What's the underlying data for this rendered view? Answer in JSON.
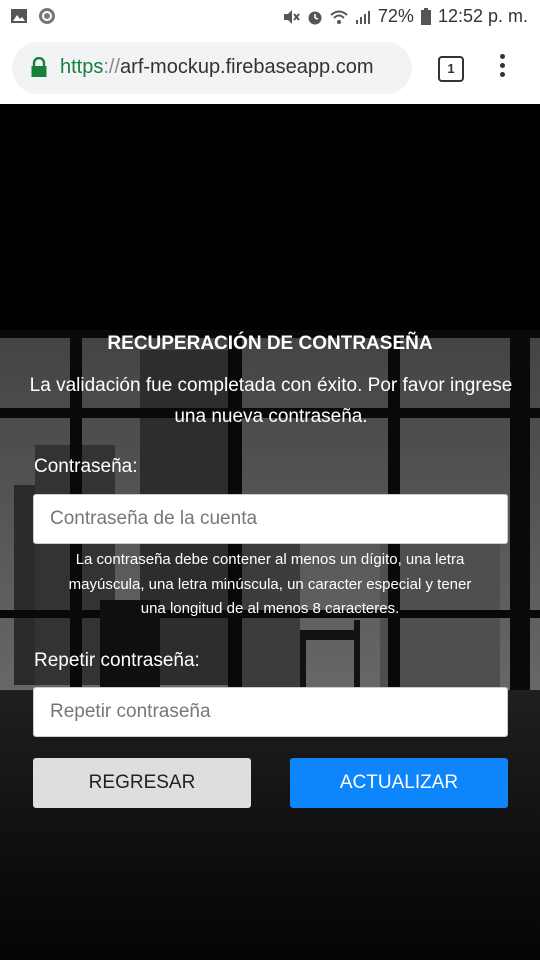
{
  "status_bar": {
    "battery_percent": "72%",
    "time": "12:52 p. m.",
    "left_icons": [
      "image-icon",
      "sync-icon"
    ],
    "right_icons": [
      "mute-icon",
      "alarm-icon",
      "wifi-icon",
      "signal-icon",
      "battery-icon"
    ]
  },
  "browser": {
    "url_scheme": "https",
    "url_sep": "://",
    "url_host": "arf-mockup.firebaseapp.com",
    "tab_count": "1"
  },
  "page": {
    "title": "RECUPERACIÓN DE CONTRASEÑA",
    "message_line1": "La validación fue completada con éxito. Por favor ingrese",
    "message_line2": "una nueva contraseña.",
    "password_label": "Contraseña:",
    "password_placeholder": "Contraseña de la cuenta",
    "hint_line1": "La contraseña debe contener al menos un dígito, una letra",
    "hint_line2": "mayúscula, una letra minúscula, un caracter especial y tener",
    "hint_line3": "una longitud de al menos 8 caracteres.",
    "repeat_label": "Repetir contraseña:",
    "repeat_placeholder": "Repetir contraseña",
    "back_button": "REGRESAR",
    "update_button": "ACTUALIZAR"
  },
  "colors": {
    "secure_scheme": "#188038",
    "primary_button": "#0d85fb",
    "secondary_button": "#dedede"
  }
}
